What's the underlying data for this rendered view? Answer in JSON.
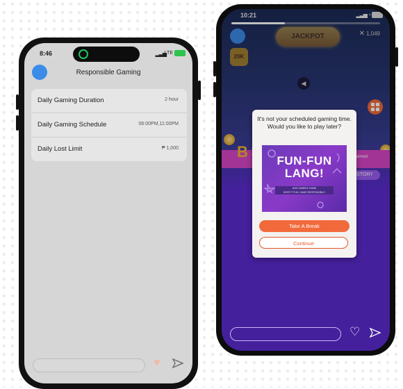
{
  "left_phone": {
    "status": {
      "time": "8:46",
      "signal_glyph": "▂▃▅",
      "network": "LTE"
    },
    "title": "Responsible Gaming",
    "settings": [
      {
        "label": "Daily Gaming Duration",
        "value": "2 hour"
      },
      {
        "label": "Daily Gaming Schedule",
        "value": "06:00PM,11:00PM"
      },
      {
        "label": "Daily Lost Limit",
        "value": "₱ 1,000"
      }
    ],
    "icons": {
      "heart": "heart-icon",
      "send": "send-icon"
    }
  },
  "right_phone": {
    "status": {
      "time": "10:21",
      "signal_glyph": "▂▃▅ ◔"
    },
    "game": {
      "jackpot_label": "JACKPOT",
      "close_glyph": "✕",
      "top_amount": "1,049",
      "badge_text": "20K",
      "speaker_glyph": "◀",
      "big_letters": "B S",
      "tag_text": "Claimed",
      "story_button": "STORY"
    },
    "dialog": {
      "message": "It's not your scheduled gaming time. Would you like to play later?",
      "banner_title": "FUN-FUN\nLANG!",
      "banner_strip": "ANG GAMBLE GAME\nKEEP IT FUN. GAME RESPONSIBLY!",
      "primary_button": "Take A Break",
      "secondary_button": "Continue"
    },
    "icons": {
      "heart": "heart-icon",
      "send": "send-icon"
    }
  },
  "colors": {
    "accent": "#f26a3b",
    "game_purple": "#5b2bd1",
    "avatar_blue": "#3b8be8",
    "battery_green": "#2ec44c"
  }
}
